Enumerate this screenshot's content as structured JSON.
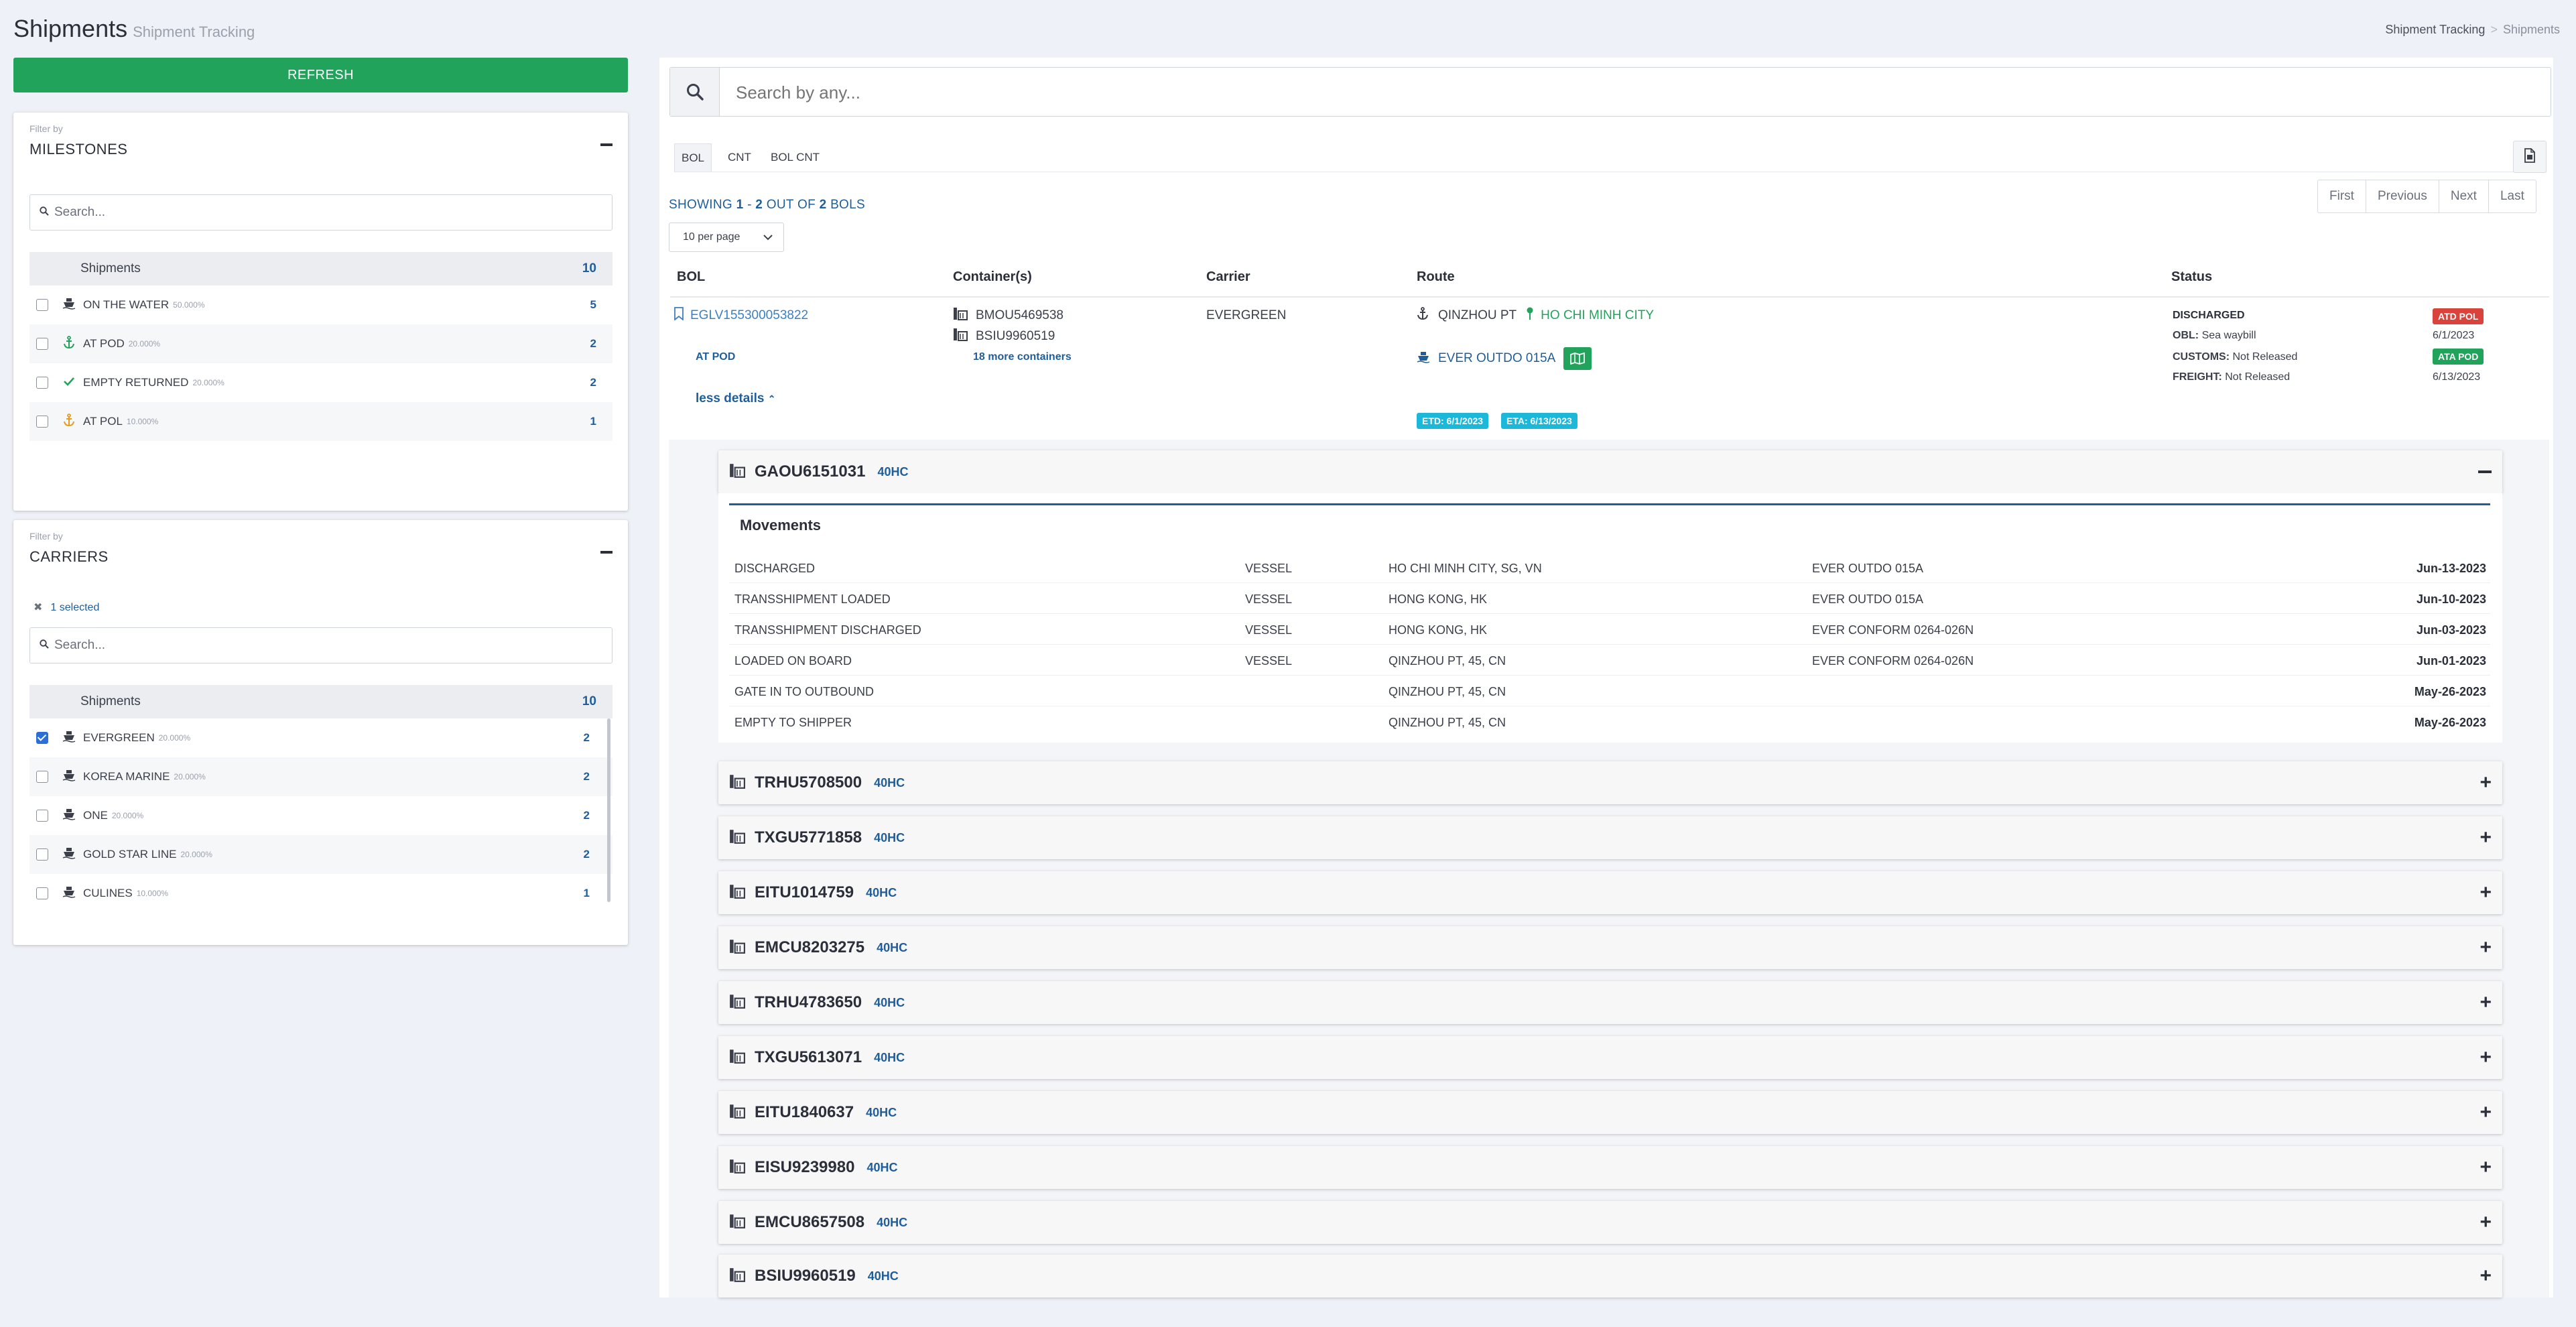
{
  "header": {
    "title": "Shipments",
    "subtitle": "Shipment Tracking",
    "breadcrumb": [
      "Shipment Tracking",
      "Shipments"
    ]
  },
  "sidebar": {
    "refresh_label": "REFRESH",
    "milestones": {
      "filter_by": "Filter by",
      "title": "MILESTONES",
      "search_placeholder": "Search...",
      "list_header": "Shipments",
      "total": "10",
      "items": [
        {
          "label": "ON THE WATER",
          "pct": "50.000%",
          "count": "5",
          "icon": "ship-icon"
        },
        {
          "label": "AT POD",
          "pct": "20.000%",
          "count": "2",
          "icon": "anchor-icon"
        },
        {
          "label": "EMPTY RETURNED",
          "pct": "20.000%",
          "count": "2",
          "icon": "check-icon"
        },
        {
          "label": "AT POL",
          "pct": "10.000%",
          "count": "1",
          "icon": "anchor-icon"
        }
      ]
    },
    "carriers": {
      "filter_by": "Filter by",
      "title": "CARRIERS",
      "selected_label": "1 selected",
      "search_placeholder": "Search...",
      "list_header": "Shipments",
      "total": "10",
      "items": [
        {
          "label": "EVERGREEN",
          "pct": "20.000%",
          "count": "2",
          "checked": true
        },
        {
          "label": "KOREA MARINE",
          "pct": "20.000%",
          "count": "2",
          "checked": false
        },
        {
          "label": "ONE",
          "pct": "20.000%",
          "count": "2",
          "checked": false
        },
        {
          "label": "GOLD STAR LINE",
          "pct": "20.000%",
          "count": "2",
          "checked": false
        },
        {
          "label": "CULINES",
          "pct": "10.000%",
          "count": "1",
          "checked": false
        }
      ]
    }
  },
  "main": {
    "search_placeholder": "Search by any...",
    "tabs": [
      "BOL",
      "CNT",
      "BOL CNT"
    ],
    "showing": {
      "prefix": "SHOWING",
      "from": "1",
      "dash": "-",
      "to": "2",
      "mid": "OUT OF",
      "total": "2",
      "suffix": "BOLS"
    },
    "per_page": "10 per page",
    "pager": [
      "First",
      "Previous",
      "Next",
      "Last"
    ],
    "columns": [
      "BOL",
      "Container(s)",
      "Carrier",
      "Route",
      "Status"
    ],
    "row": {
      "bol": "EGLV155300053822",
      "milestone": "AT POD",
      "less_details": "less details",
      "containers": [
        "BMOU5469538",
        "BSIU9960519"
      ],
      "more_containers": "18 more containers",
      "carrier": "EVERGREEN",
      "route_from": "QINZHOU PT",
      "route_to": "HO CHI MINH CITY",
      "vessel": "EVER OUTDO 015A",
      "etd": "ETD: 6/1/2023",
      "eta": "ETA: 6/13/2023",
      "status_main": "DISCHARGED",
      "status_badge_1": "ATD POL",
      "obl_label": "OBL:",
      "obl_value": "Sea waybill",
      "obl_date": "6/1/2023",
      "customs_label": "CUSTOMS:",
      "customs_value": "Not Released",
      "status_badge_2": "ATA POD",
      "freight_label": "FREIGHT:",
      "freight_value": "Not Released",
      "freight_date": "6/13/2023"
    },
    "expanded_container": {
      "name": "GAOU6151031",
      "type": "40HC",
      "movements_title": "Movements",
      "movements": [
        {
          "event": "DISCHARGED",
          "mode": "VESSEL",
          "location": "HO CHI MINH CITY, SG, VN",
          "vessel": "EVER OUTDO 015A",
          "date": "Jun-13-2023"
        },
        {
          "event": "TRANSSHIPMENT LOADED",
          "mode": "VESSEL",
          "location": "HONG KONG, HK",
          "vessel": "EVER OUTDO 015A",
          "date": "Jun-10-2023"
        },
        {
          "event": "TRANSSHIPMENT DISCHARGED",
          "mode": "VESSEL",
          "location": "HONG KONG, HK",
          "vessel": "EVER CONFORM 0264-026N",
          "date": "Jun-03-2023"
        },
        {
          "event": "LOADED ON BOARD",
          "mode": "VESSEL",
          "location": "QINZHOU PT, 45, CN",
          "vessel": "EVER CONFORM 0264-026N",
          "date": "Jun-01-2023"
        },
        {
          "event": "GATE IN TO OUTBOUND",
          "mode": "",
          "location": "QINZHOU PT, 45, CN",
          "vessel": "",
          "date": "May-26-2023"
        },
        {
          "event": "EMPTY TO SHIPPER",
          "mode": "",
          "location": "QINZHOU PT, 45, CN",
          "vessel": "",
          "date": "May-26-2023"
        }
      ]
    },
    "collapsed_containers": [
      {
        "name": "TRHU5708500",
        "type": "40HC"
      },
      {
        "name": "TXGU5771858",
        "type": "40HC"
      },
      {
        "name": "EITU1014759",
        "type": "40HC"
      },
      {
        "name": "EMCU8203275",
        "type": "40HC"
      },
      {
        "name": "TRHU4783650",
        "type": "40HC"
      },
      {
        "name": "TXGU5613071",
        "type": "40HC"
      },
      {
        "name": "EITU1840637",
        "type": "40HC"
      },
      {
        "name": "EISU9239980",
        "type": "40HC"
      },
      {
        "name": "EMCU8657508",
        "type": "40HC"
      },
      {
        "name": "BSIU9960519",
        "type": "40HC"
      }
    ],
    "colors": {
      "accent": "#1f5e9a",
      "green": "#21a35c",
      "red": "#d9433b",
      "cyan": "#1cb8d9"
    }
  }
}
